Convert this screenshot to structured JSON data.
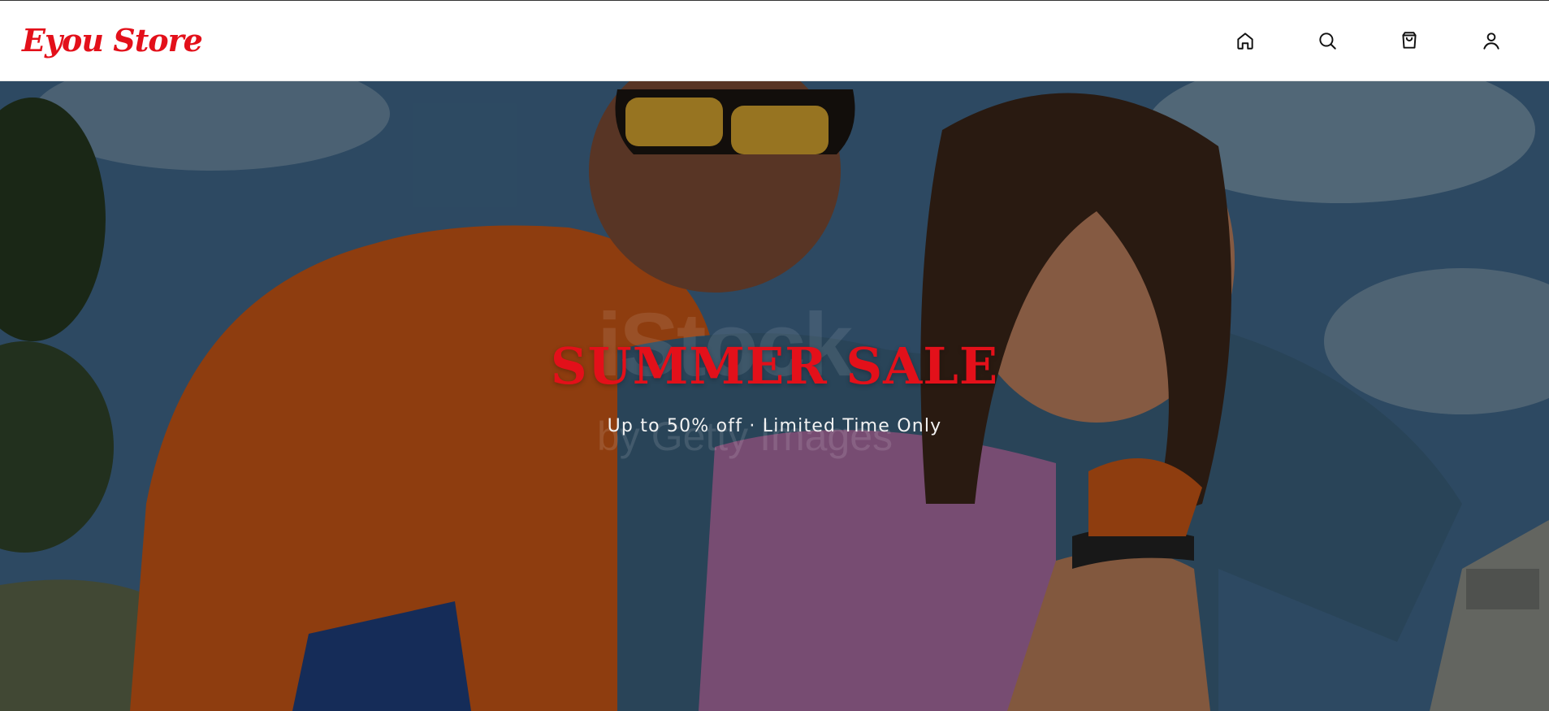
{
  "header": {
    "brand": "Eyou Store",
    "icons": [
      {
        "name": "home-icon"
      },
      {
        "name": "search-icon"
      },
      {
        "name": "shopping-bag-icon"
      },
      {
        "name": "user-icon"
      }
    ]
  },
  "hero": {
    "title": "SUMMER SALE",
    "subtitle": "Up to 50% off · Limited Time Only",
    "watermark": "iStock",
    "watermark_sub": "by Getty Images"
  },
  "colors": {
    "brand": "#e3101a",
    "subtitle": "#f3f3f3"
  }
}
